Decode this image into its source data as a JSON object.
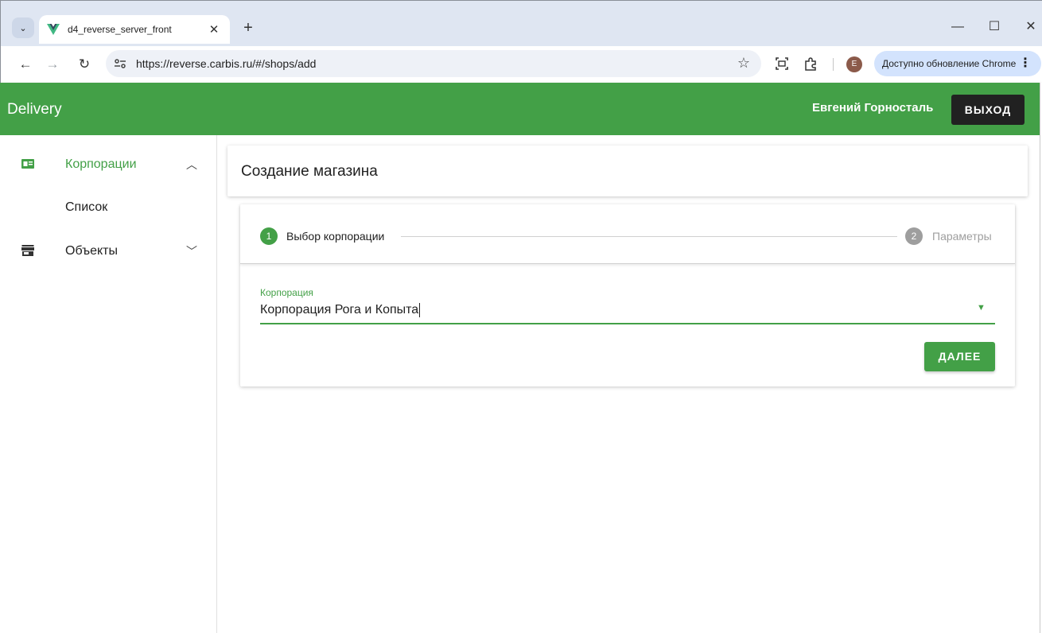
{
  "browser": {
    "tab_title": "d4_reverse_server_front",
    "url": "https://reverse.carbis.ru/#/shops/add",
    "avatar_letter": "E",
    "update_text": "Доступно обновление Chrome"
  },
  "app": {
    "title": "Delivery",
    "user_name": "Евгений Горносталь",
    "logout_label": "Выход"
  },
  "sidebar": {
    "items": [
      {
        "label": "Корпорации",
        "icon": "business-card-icon",
        "expanded": true
      },
      {
        "label": "Объекты",
        "icon": "store-icon",
        "expanded": false
      }
    ],
    "subitems": [
      {
        "label": "Список"
      }
    ]
  },
  "main": {
    "page_title": "Создание магазина",
    "steps": [
      {
        "num": "1",
        "label": "Выбор корпорации",
        "active": true
      },
      {
        "num": "2",
        "label": "Параметры",
        "active": false
      }
    ],
    "corporation_field": {
      "label": "Корпорация",
      "value": "Корпорация Рога и Копыта"
    },
    "next_label": "ДАЛЕЕ"
  },
  "colors": {
    "primary": "#43a047",
    "dark_button": "#212121",
    "inactive_step": "#9e9e9e"
  }
}
